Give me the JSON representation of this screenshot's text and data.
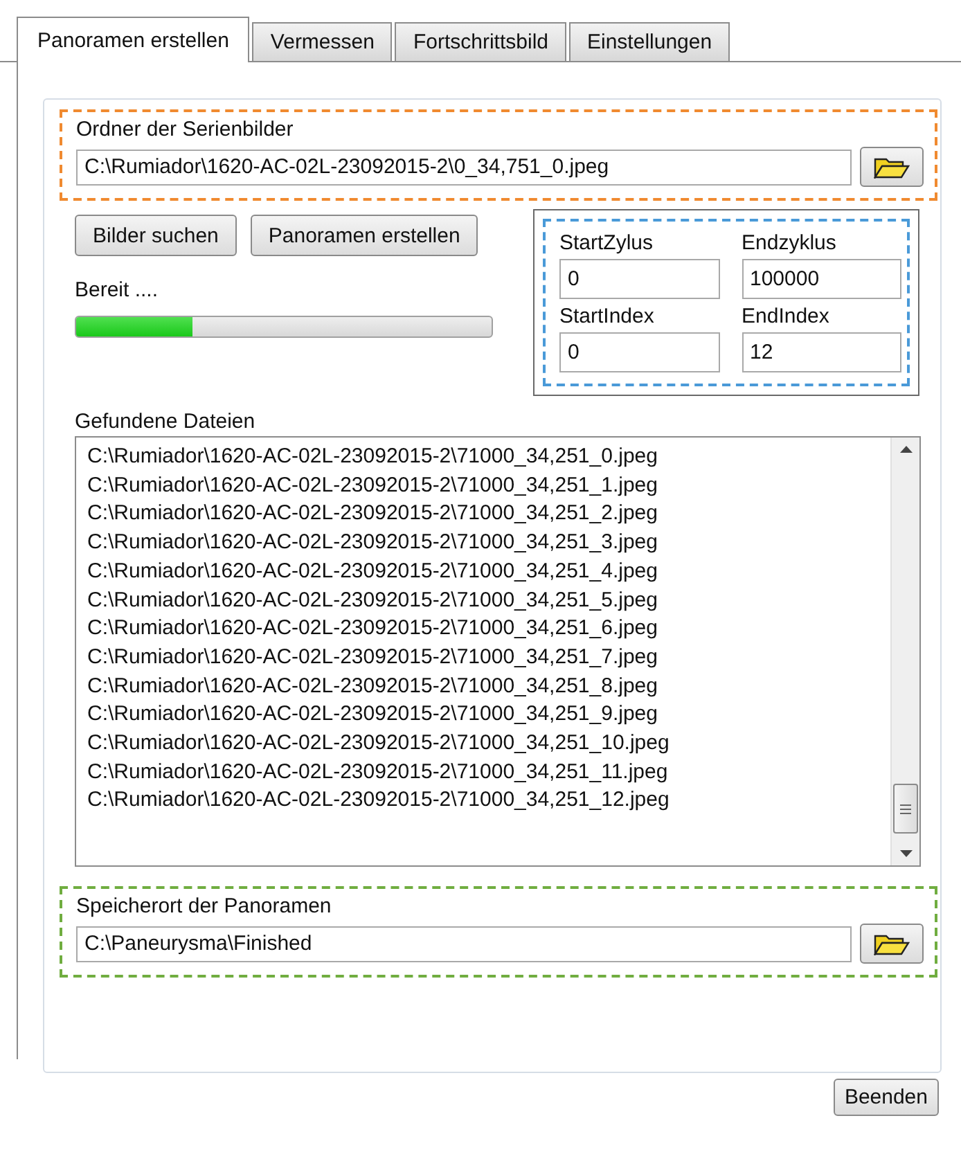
{
  "tabs": [
    {
      "label": "Panoramen erstellen",
      "selected": true
    },
    {
      "label": "Vermessen",
      "selected": false
    },
    {
      "label": "Fortschrittsbild",
      "selected": false
    },
    {
      "label": "Einstellungen",
      "selected": false
    }
  ],
  "source": {
    "label": "Ordner der Serienbilder",
    "value": "C:\\Rumiador\\1620-AC-02L-23092015-2\\0_34,751_0.jpeg"
  },
  "actions": [
    "Bilder suchen",
    "Panoramen erstellen"
  ],
  "status": "Bereit ....",
  "progress": {
    "level": 0.28
  },
  "range": [
    {
      "label": "StartZylus",
      "value": "0"
    },
    {
      "label": "Endzyklus",
      "value": "100000"
    },
    {
      "label": "StartIndex",
      "value": "0"
    },
    {
      "label": "EndIndex",
      "value": "12"
    }
  ],
  "files": {
    "label": "Gefundene Dateien",
    "items": [
      "C:\\Rumiador\\1620-AC-02L-23092015-2\\71000_34,251_0.jpeg",
      "C:\\Rumiador\\1620-AC-02L-23092015-2\\71000_34,251_1.jpeg",
      "C:\\Rumiador\\1620-AC-02L-23092015-2\\71000_34,251_2.jpeg",
      "C:\\Rumiador\\1620-AC-02L-23092015-2\\71000_34,251_3.jpeg",
      "C:\\Rumiador\\1620-AC-02L-23092015-2\\71000_34,251_4.jpeg",
      "C:\\Rumiador\\1620-AC-02L-23092015-2\\71000_34,251_5.jpeg",
      "C:\\Rumiador\\1620-AC-02L-23092015-2\\71000_34,251_6.jpeg",
      "C:\\Rumiador\\1620-AC-02L-23092015-2\\71000_34,251_7.jpeg",
      "C:\\Rumiador\\1620-AC-02L-23092015-2\\71000_34,251_8.jpeg",
      "C:\\Rumiador\\1620-AC-02L-23092015-2\\71000_34,251_9.jpeg",
      "C:\\Rumiador\\1620-AC-02L-23092015-2\\71000_34,251_10.jpeg",
      "C:\\Rumiador\\1620-AC-02L-23092015-2\\71000_34,251_11.jpeg",
      "C:\\Rumiador\\1620-AC-02L-23092015-2\\71000_34,251_12.jpeg"
    ]
  },
  "target": {
    "label": "Speicherort der Panoramen",
    "value": "C:\\Paneurysma\\Finished"
  },
  "buttons": [
    "Beenden"
  ]
}
